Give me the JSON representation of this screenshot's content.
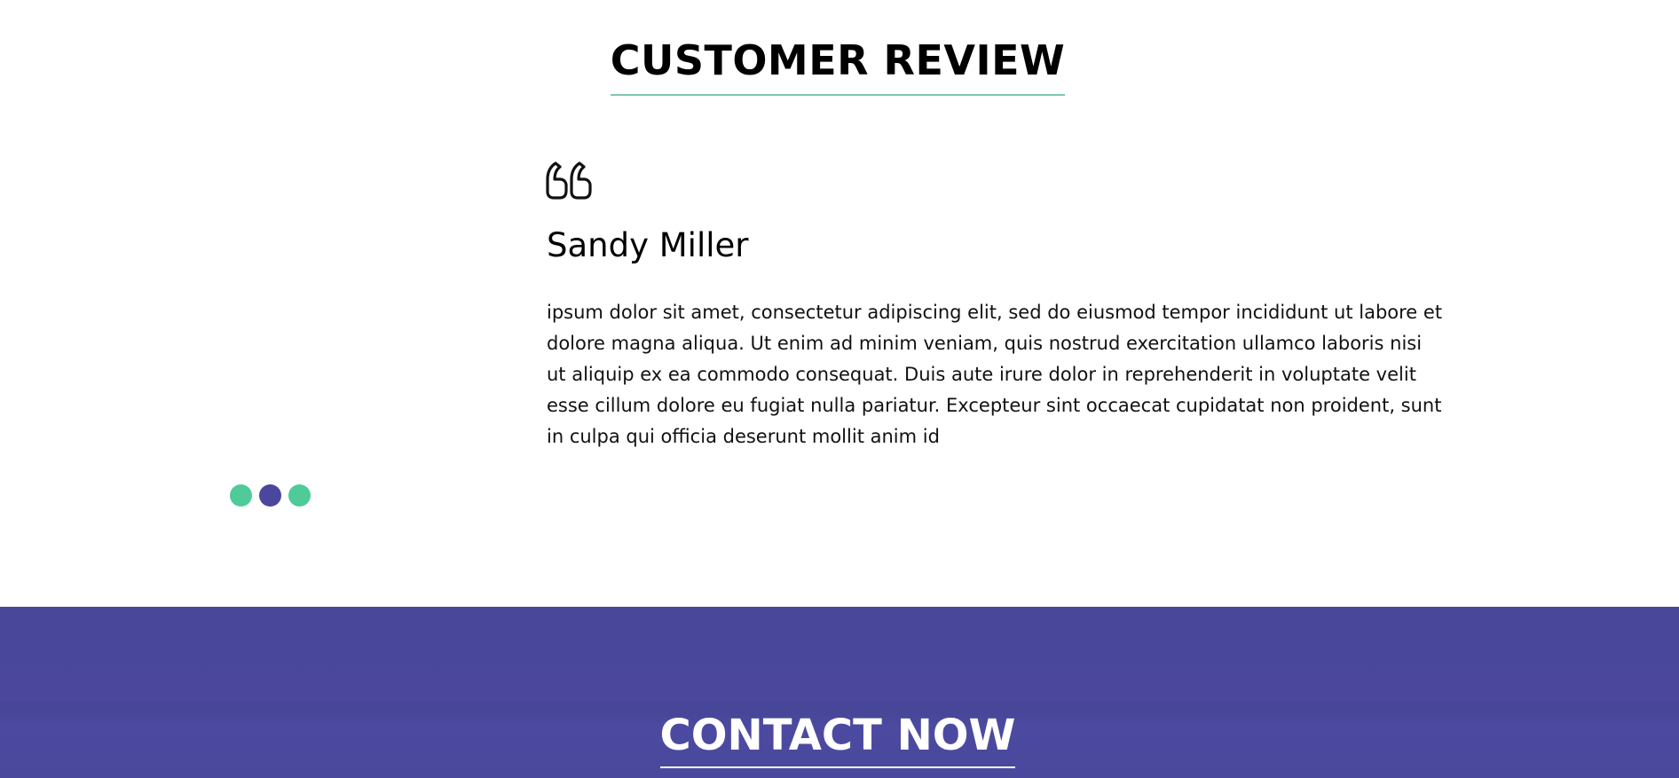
{
  "review_section": {
    "title": "CUSTOMER REVIEW",
    "quote_icon": "quote-open-icon",
    "review": {
      "name": "Sandy Miller",
      "text": "ipsum dolor sit amet, consectetur adipiscing elit, sed do eiusmod tempor incididunt ut labore et dolore magna aliqua. Ut enim ad minim veniam, quis nostrud exercitation ullamco laboris nisi ut aliquip ex ea commodo consequat. Duis aute irure dolor in reprehenderit in voluptate velit esse cillum dolore eu fugiat nulla pariatur. Excepteur sint occaecat cupidatat non proident, sunt in culpa qui officia deserunt mollit anim id"
    },
    "slider_dots": [
      {
        "active": false,
        "color": "#4ecb98"
      },
      {
        "active": true,
        "color": "#4a479c"
      },
      {
        "active": false,
        "color": "#4ecb98"
      }
    ],
    "title_underline_color": "#7fc7b3"
  },
  "contact_section": {
    "title": "CONTACT NOW",
    "background_color": "#4a479c"
  }
}
